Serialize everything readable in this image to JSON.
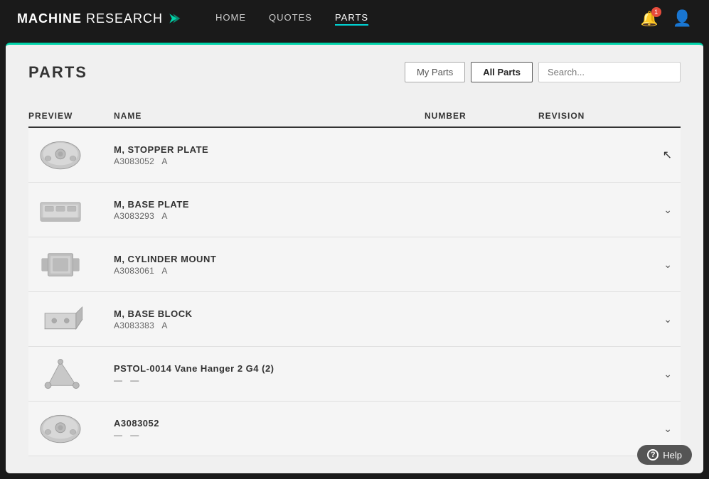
{
  "brand": {
    "machine": "MACHINE",
    "research": "RESEARCH"
  },
  "nav": {
    "links": [
      {
        "label": "HOME",
        "active": false
      },
      {
        "label": "QUOTES",
        "active": false
      },
      {
        "label": "PARTS",
        "active": true
      }
    ]
  },
  "header": {
    "notification_count": "1",
    "my_parts_label": "My Parts",
    "all_parts_label": "All Parts",
    "search_placeholder": "Search..."
  },
  "page": {
    "title": "PARTS"
  },
  "table": {
    "columns": [
      "PREVIEW",
      "NAME",
      "NUMBER",
      "REVISION"
    ],
    "rows": [
      {
        "name": "M, STOPPER PLATE",
        "number": "A3083052",
        "revision": "A",
        "sub": "A3083052  A",
        "has_cursor": true
      },
      {
        "name": "M, BASE PLATE",
        "number": "A3083293",
        "revision": "A",
        "sub": "A3083293  A",
        "has_cursor": false
      },
      {
        "name": "M, CYLINDER MOUNT",
        "number": "A3083061",
        "revision": "A",
        "sub": "A3083061  A",
        "has_cursor": false
      },
      {
        "name": "M, BASE BLOCK",
        "number": "A3083383",
        "revision": "A",
        "sub": "A3083383  A",
        "has_cursor": false
      },
      {
        "name": "PSTOL-0014 Vane Hanger 2 G4 (2)",
        "number": "—",
        "revision": "—",
        "sub": "— —",
        "has_cursor": false
      },
      {
        "name": "A3083052",
        "number": "—",
        "revision": "—",
        "sub": "— —",
        "has_cursor": false
      }
    ]
  },
  "help": {
    "label": "Help"
  }
}
